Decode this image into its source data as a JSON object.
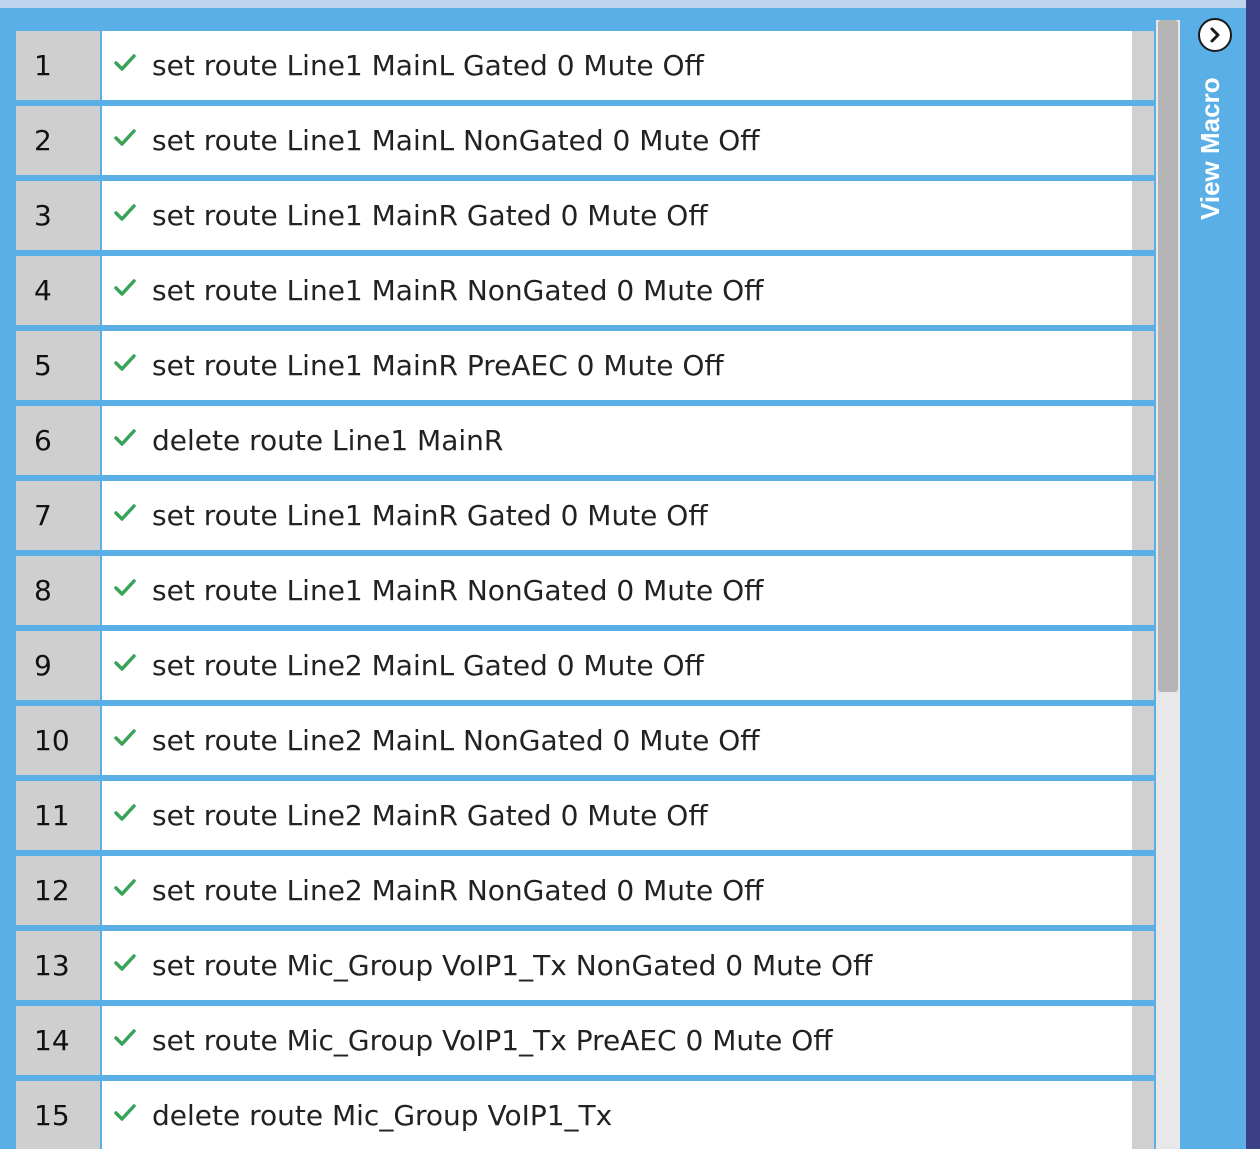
{
  "side_tab": {
    "label": "View Macro",
    "expand_icon": "chevron-right-icon"
  },
  "colors": {
    "panel": "#5aafe6",
    "check": "#3aa35a"
  },
  "rows": [
    {
      "num": "1",
      "text": "set route Line1 MainL Gated 0 Mute Off"
    },
    {
      "num": "2",
      "text": "set route Line1 MainL NonGated 0 Mute Off"
    },
    {
      "num": "3",
      "text": "set route Line1 MainR Gated 0 Mute Off"
    },
    {
      "num": "4",
      "text": "set route Line1 MainR NonGated 0 Mute Off"
    },
    {
      "num": "5",
      "text": "set route Line1 MainR PreAEC 0 Mute Off"
    },
    {
      "num": "6",
      "text": "delete route Line1 MainR"
    },
    {
      "num": "7",
      "text": "set route Line1 MainR Gated 0 Mute Off"
    },
    {
      "num": "8",
      "text": "set route Line1 MainR NonGated 0 Mute Off"
    },
    {
      "num": "9",
      "text": "set route Line2 MainL Gated 0 Mute Off"
    },
    {
      "num": "10",
      "text": "set route Line2 MainL NonGated 0 Mute Off"
    },
    {
      "num": "11",
      "text": "set route Line2 MainR Gated 0 Mute Off"
    },
    {
      "num": "12",
      "text": "set route Line2 MainR NonGated 0 Mute Off"
    },
    {
      "num": "13",
      "text": "set route Mic_Group VoIP1_Tx NonGated 0 Mute Off"
    },
    {
      "num": "14",
      "text": "set route Mic_Group VoIP1_Tx PreAEC 0 Mute Off"
    },
    {
      "num": "15",
      "text": "delete route Mic_Group VoIP1_Tx"
    }
  ]
}
